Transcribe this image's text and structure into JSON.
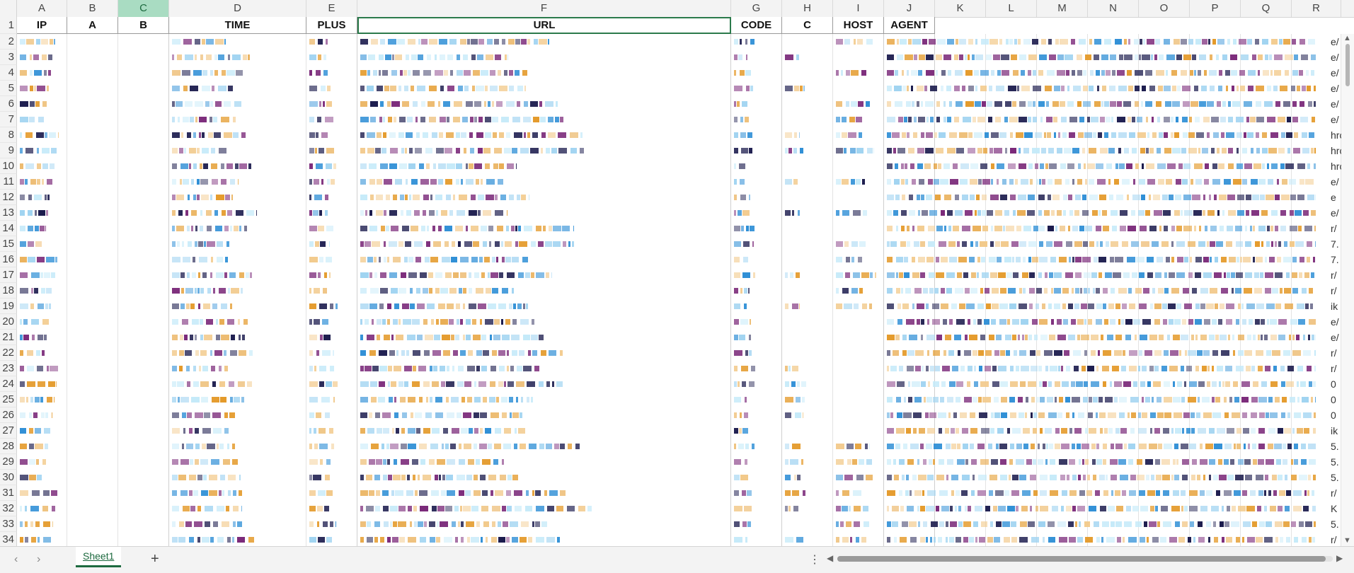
{
  "app": {
    "active_tab": "Sheet1"
  },
  "columns": {
    "letters": [
      "A",
      "B",
      "C",
      "D",
      "E",
      "F",
      "G",
      "H",
      "I",
      "J",
      "K",
      "L",
      "M",
      "N",
      "O",
      "P",
      "Q",
      "R"
    ],
    "selected": "C"
  },
  "header_row": {
    "number": "1",
    "labels": [
      "IP",
      "A",
      "B",
      "TIME",
      "PLUS",
      "URL",
      "CODE",
      "C",
      "HOST",
      "AGENT"
    ]
  },
  "rows": [
    "2",
    "3",
    "4",
    "5",
    "6",
    "7",
    "8",
    "9",
    "10",
    "11",
    "12",
    "13",
    "14",
    "15",
    "16",
    "17",
    "18",
    "19",
    "20",
    "21",
    "22",
    "23",
    "24",
    "25",
    "26",
    "27",
    "28",
    "29",
    "30",
    "31",
    "32",
    "33",
    "34"
  ],
  "right_edge_text": [
    "e/",
    "e/",
    "e/",
    "e/",
    "e/",
    "e/",
    "hrc",
    "hrc",
    "hrc",
    "e/",
    "e",
    "e/",
    "r/",
    "7.",
    "7.",
    "r/",
    "r/",
    "ik",
    "e/",
    "e/",
    "r/",
    "r/",
    "0",
    "0",
    "0",
    "ik",
    "5.",
    "5.",
    "5.",
    "r/",
    "K",
    "5.",
    "r/"
  ],
  "tabs": {
    "sheets": [
      "Sheet1"
    ],
    "add_label": "+"
  },
  "colors": {
    "accent": "#1d6a3f",
    "selected_col": "#a9dcc2"
  }
}
